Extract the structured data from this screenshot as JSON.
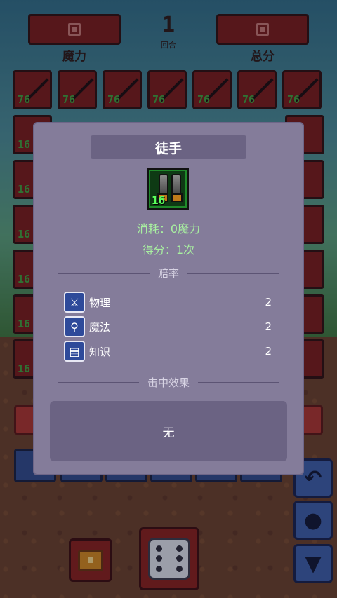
{
  "top_bar": {
    "left_label": "魔力",
    "right_label": "总分",
    "round_number": "1",
    "round_label": "回合"
  },
  "grid": {
    "top_row_values": [
      "76",
      "76",
      "76",
      "76",
      "76",
      "76",
      "76"
    ],
    "side_values": [
      "16",
      "16",
      "16",
      "16",
      "16",
      "16"
    ]
  },
  "modal": {
    "title": "徒手",
    "item_level": "16",
    "cost_text": "消耗：0魔力",
    "score_text": "得分：1次",
    "odds_header": "赔率",
    "stats": [
      {
        "label": "物理",
        "value": "2",
        "icon": "sword-icon"
      },
      {
        "label": "魔法",
        "value": "2",
        "icon": "staff-icon"
      },
      {
        "label": "知识",
        "value": "2",
        "icon": "book-icon"
      }
    ],
    "effect_header": "击中效果",
    "effect_text": "无"
  },
  "colors": {
    "modal_bg": "#847c9a",
    "panel_bg": "#6b6383",
    "cost_text": "#a8f0a0",
    "cell_red": "#7a1a14",
    "button_blue": "#3b5ea8"
  }
}
